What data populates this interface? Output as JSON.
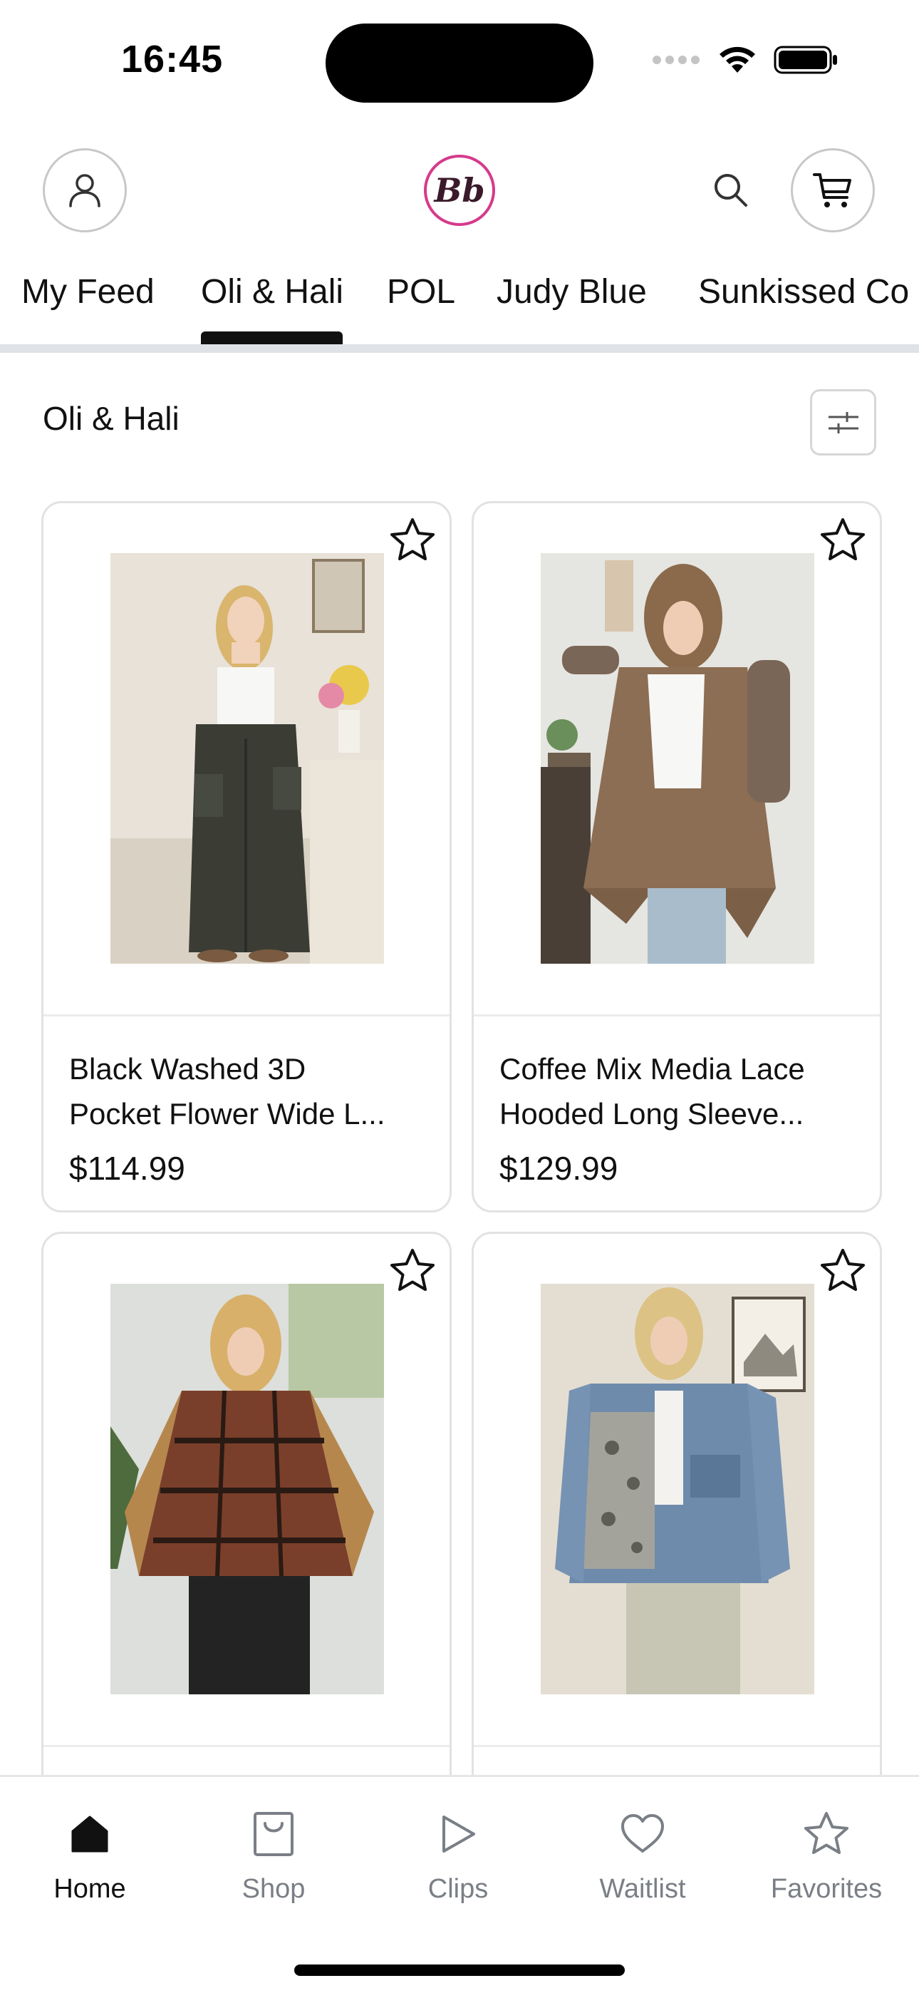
{
  "status_bar": {
    "time": "16:45"
  },
  "header": {
    "logo_text": "Bb",
    "icons": [
      "profile-icon",
      "search-icon",
      "cart-icon"
    ]
  },
  "tabs": [
    {
      "label": "My Feed"
    },
    {
      "label": "Oli & Hali",
      "active": true
    },
    {
      "label": "POL"
    },
    {
      "label": "Judy Blue"
    },
    {
      "label": "Sunkissed Co"
    }
  ],
  "section": {
    "title": "Oli & Hali"
  },
  "products": [
    {
      "name_line1": "Black Washed 3D",
      "name_line2": "Pocket Flower Wide L...",
      "price": "$114.99"
    },
    {
      "name_line1": "Coffee Mix Media Lace",
      "name_line2": "Hooded Long Sleeve...",
      "price": "$129.99"
    },
    {
      "name_line1": "",
      "name_line2": "",
      "price": ""
    },
    {
      "name_line1": "",
      "name_line2": "",
      "price": ""
    }
  ],
  "bottom_nav": [
    {
      "label": "Home",
      "icon": "home-icon",
      "active": true
    },
    {
      "label": "Shop",
      "icon": "shop-bag-icon"
    },
    {
      "label": "Clips",
      "icon": "play-icon"
    },
    {
      "label": "Waitlist",
      "icon": "heart-icon"
    },
    {
      "label": "Favorites",
      "icon": "star-icon"
    }
  ],
  "colors": {
    "accent": "#111111",
    "logo_ring": "#d63a8c",
    "inactive_nav": "#7a7f86",
    "divider": "#dfe2e6"
  }
}
